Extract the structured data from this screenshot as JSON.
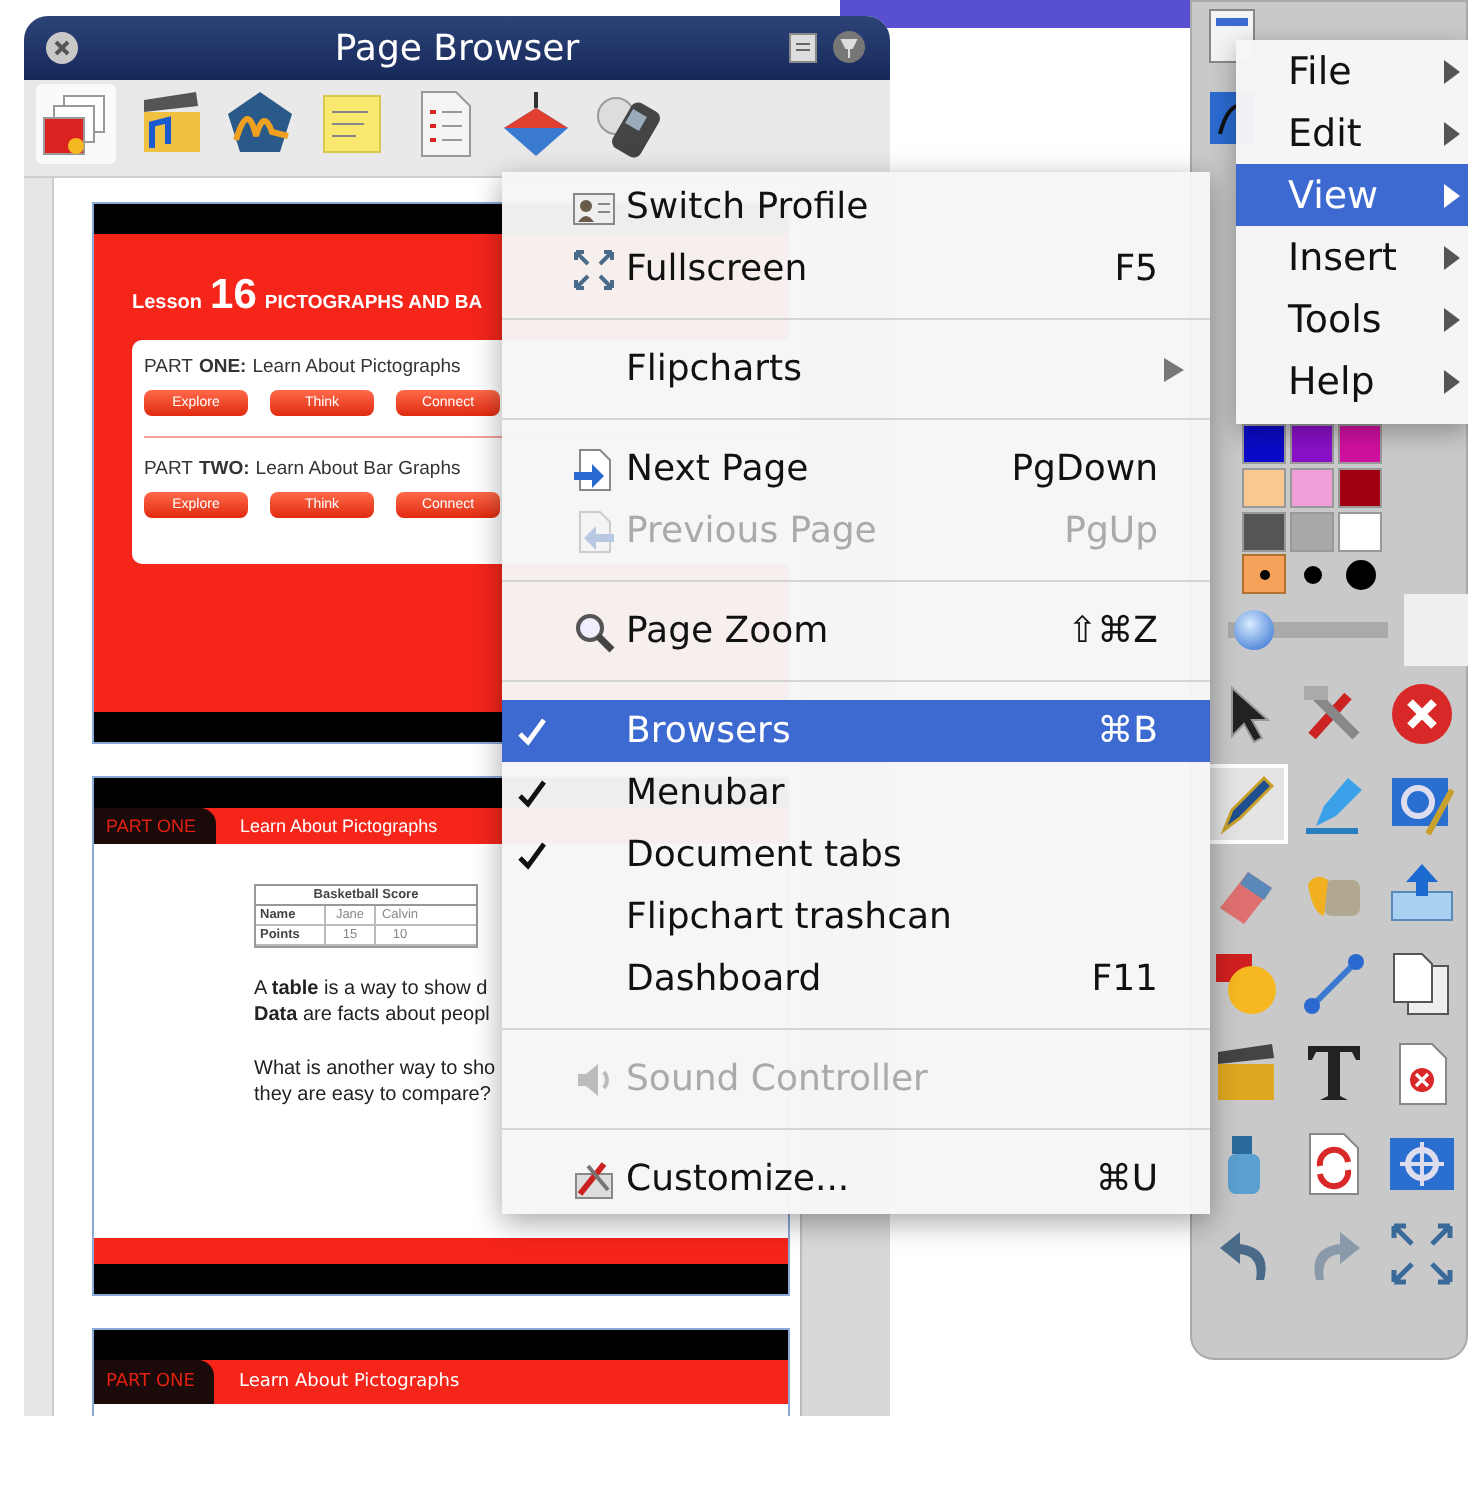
{
  "page_browser": {
    "title": "Page Browser",
    "toolbar": [
      {
        "selected": true
      },
      {
        "selected": false
      },
      {
        "selected": false
      },
      {
        "selected": false
      },
      {
        "selected": false
      },
      {
        "selected": false
      },
      {
        "selected": false
      }
    ],
    "pages": [
      {
        "kind": "title",
        "lesson_label": "Lesson",
        "lesson_number": "16",
        "title": "PICTOGRAPHS AND BA",
        "parts": [
          {
            "label": "PART",
            "ordinal": "ONE:",
            "topic": "Learn About Pictographs",
            "buttons": [
              "Explore",
              "Think",
              "Connect"
            ]
          },
          {
            "label": "PART",
            "ordinal": "TWO:",
            "topic": "Learn About Bar Graphs",
            "buttons": [
              "Explore",
              "Think",
              "Connect"
            ]
          }
        ]
      },
      {
        "kind": "content",
        "header_label": "PART ONE",
        "header_title": "Learn About Pictographs",
        "table": {
          "title": "Basketball Score",
          "rows": [
            [
              "Name",
              "Jane",
              "Calvin"
            ],
            [
              "Points",
              "15",
              "10"
            ]
          ]
        },
        "paragraphs": [
          [
            "A **table** is a way to show d",
            "**Data** are facts about peopl"
          ],
          [
            "What is another way to sho",
            "they are easy to compare?"
          ]
        ]
      },
      {
        "kind": "header",
        "header_label": "PART ONE",
        "header_title": "Learn About Pictographs"
      }
    ]
  },
  "view_menu": {
    "items": [
      {
        "kind": "item",
        "label": "Switch Profile",
        "checked": false,
        "disabled": false,
        "selected": false,
        "submenu": false
      },
      {
        "kind": "item",
        "label": "Fullscreen",
        "shortcut": "F5",
        "checked": false,
        "disabled": false,
        "selected": false,
        "submenu": false
      },
      {
        "kind": "separator"
      },
      {
        "kind": "item",
        "label": "Flipcharts",
        "checked": false,
        "disabled": false,
        "selected": false,
        "submenu": true
      },
      {
        "kind": "separator"
      },
      {
        "kind": "item",
        "label": "Next Page",
        "shortcut": "PgDown",
        "checked": false,
        "disabled": false,
        "selected": false,
        "submenu": false
      },
      {
        "kind": "item",
        "label": "Previous Page",
        "shortcut": "PgUp",
        "checked": false,
        "disabled": true,
        "selected": false,
        "submenu": false
      },
      {
        "kind": "separator"
      },
      {
        "kind": "item",
        "label": "Page Zoom",
        "shortcut": "⇧⌘Z",
        "checked": false,
        "disabled": false,
        "selected": false,
        "submenu": false
      },
      {
        "kind": "separator"
      },
      {
        "kind": "item",
        "label": "Browsers",
        "shortcut": "⌘B",
        "checked": true,
        "disabled": false,
        "selected": true,
        "submenu": false
      },
      {
        "kind": "item",
        "label": "Menubar",
        "checked": true,
        "disabled": false,
        "selected": false,
        "submenu": false
      },
      {
        "kind": "item",
        "label": "Document tabs",
        "checked": true,
        "disabled": false,
        "selected": false,
        "submenu": false
      },
      {
        "kind": "item",
        "label": "Flipchart trashcan",
        "checked": false,
        "disabled": false,
        "selected": false,
        "submenu": false
      },
      {
        "kind": "item",
        "label": "Dashboard",
        "shortcut": "F11",
        "checked": false,
        "disabled": false,
        "selected": false,
        "submenu": false
      },
      {
        "kind": "separator"
      },
      {
        "kind": "item",
        "label": "Sound Controller",
        "checked": false,
        "disabled": true,
        "selected": false,
        "submenu": false
      },
      {
        "kind": "separator"
      },
      {
        "kind": "item",
        "label": "Customize...",
        "shortcut": "⌘U",
        "checked": false,
        "disabled": false,
        "selected": false,
        "submenu": false
      }
    ]
  },
  "main_menu": {
    "items": [
      {
        "label": "File",
        "selected": false
      },
      {
        "label": "Edit",
        "selected": false
      },
      {
        "label": "View",
        "selected": true
      },
      {
        "label": "Insert",
        "selected": false
      },
      {
        "label": "Tools",
        "selected": false
      },
      {
        "label": "Help",
        "selected": false
      }
    ]
  },
  "toolbox": {
    "swatches": [
      {
        "color": "#0a0ac8"
      },
      {
        "color": "#8a10c8"
      },
      {
        "color": "#d010a0"
      },
      {
        "color": "#f9c890"
      },
      {
        "color": "#f0a0d8"
      },
      {
        "color": "#a00010"
      },
      {
        "color": "#555555"
      },
      {
        "color": "#a8a8a8"
      },
      {
        "color": "#ffffff"
      }
    ],
    "pen_sizes": [
      {
        "selected": true
      },
      {
        "selected": false
      },
      {
        "selected": false
      }
    ],
    "thickness_slider": {
      "level": 0.05
    },
    "tools": [
      {
        "selected": false
      },
      {
        "selected": false
      },
      {
        "selected": false
      },
      {
        "selected": true
      },
      {
        "selected": false
      },
      {
        "selected": false
      },
      {
        "selected": false
      },
      {
        "selected": false
      },
      {
        "selected": false
      },
      {
        "selected": false
      },
      {
        "selected": false
      },
      {
        "selected": false
      },
      {
        "selected": false
      },
      {
        "selected": false
      },
      {
        "selected": false
      },
      {
        "selected": false
      },
      {
        "selected": false
      },
      {
        "selected": false
      },
      {
        "selected": false
      },
      {
        "selected": false
      },
      {
        "selected": false
      }
    ]
  }
}
